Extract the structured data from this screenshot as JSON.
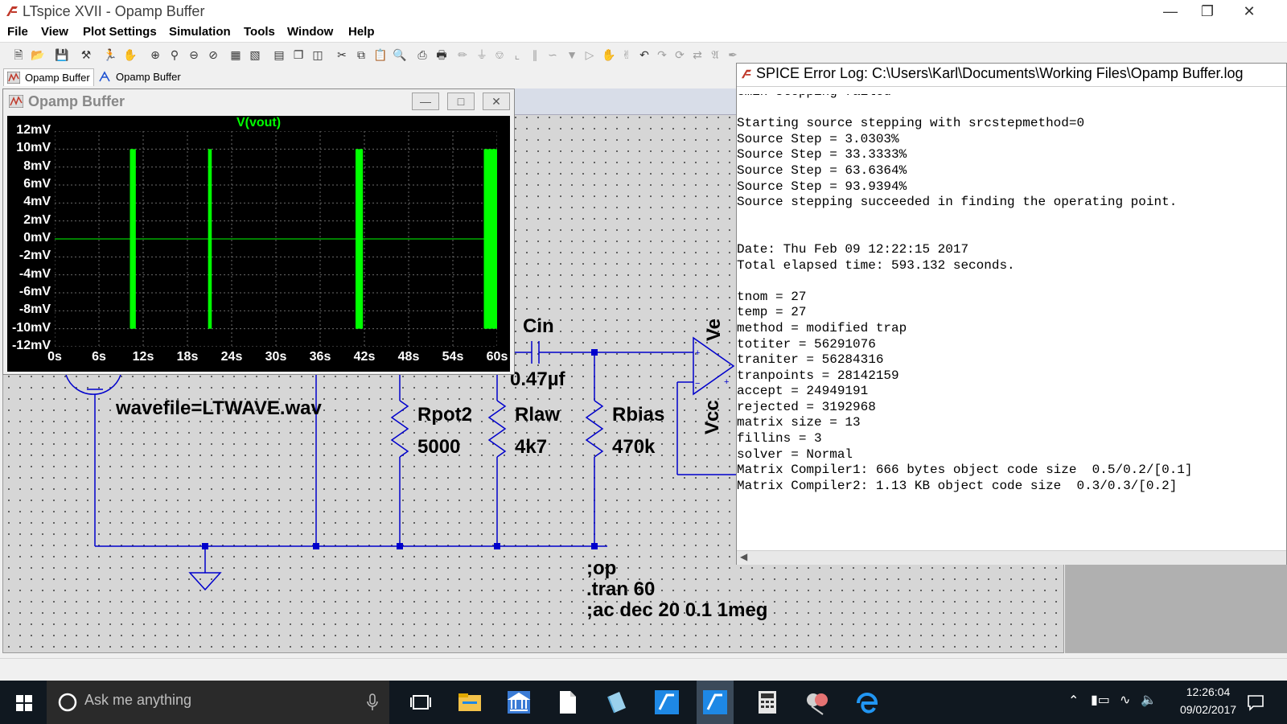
{
  "app": {
    "title": "LTspice XVII - Opamp Buffer",
    "logo_color": "#c0392b"
  },
  "menu": {
    "file": "File",
    "view": "View",
    "plot_settings": "Plot Settings",
    "simulation": "Simulation",
    "tools": "Tools",
    "window": "Window",
    "help": "Help"
  },
  "tabs": [
    {
      "label": "Opamp Buffer",
      "icon": "waveform-icon"
    },
    {
      "label": "Opamp Buffer",
      "icon": "schematic-icon"
    }
  ],
  "waveform": {
    "window_title": "Opamp Buffer",
    "trace_name": "V(vout)",
    "trace_color": "#00ff00",
    "y_ticks": [
      "12mV",
      "10mV",
      "8mV",
      "6mV",
      "4mV",
      "2mV",
      "0mV",
      "-2mV",
      "-4mV",
      "-6mV",
      "-8mV",
      "-10mV",
      "-12mV"
    ],
    "x_ticks": [
      "0s",
      "6s",
      "12s",
      "18s",
      "24s",
      "30s",
      "36s",
      "42s",
      "48s",
      "54s",
      "60s"
    ]
  },
  "schematic": {
    "cin_label": "Cin",
    "cin_value": "0.47µf",
    "wavefile": "wavefile=LTWAVE.wav",
    "rpot2_name": "Rpot2",
    "rpot2_value": "5000",
    "rlaw_name": "Rlaw",
    "rlaw_value": "4k7",
    "rbias_name": "Rbias",
    "rbias_value": "470k",
    "ve_label": "Ve",
    "vcc_label": "Vcc",
    "directive_1": ";op",
    "directive_2": ".tran 60",
    "directive_3": ";ac dec 20 0.1 1meg",
    "wire_color": "#0000cc"
  },
  "error_log": {
    "title": "SPICE Error Log: C:\\Users\\Karl\\Documents\\Working Files\\Opamp Buffer.log",
    "lines": [
      "Gmin stepping failed",
      "",
      "Starting source stepping with srcstepmethod=0",
      "Source Step = 3.0303%",
      "Source Step = 33.3333%",
      "Source Step = 63.6364%",
      "Source Step = 93.9394%",
      "Source stepping succeeded in finding the operating point.",
      "",
      "",
      "Date: Thu Feb 09 12:22:15 2017",
      "Total elapsed time: 593.132 seconds.",
      "",
      "tnom = 27",
      "temp = 27",
      "method = modified trap",
      "totiter = 56291076",
      "traniter = 56284316",
      "tranpoints = 28142159",
      "accept = 24949191",
      "rejected = 3192968",
      "matrix size = 13",
      "fillins = 3",
      "solver = Normal",
      "Matrix Compiler1: 666 bytes object code size  0.5/0.2/[0.1]",
      "Matrix Compiler2: 1.13 KB object code size  0.3/0.3/[0.2]"
    ]
  },
  "taskbar": {
    "search_placeholder": "Ask me anything",
    "time": "12:26:04",
    "date": "09/02/2017"
  }
}
